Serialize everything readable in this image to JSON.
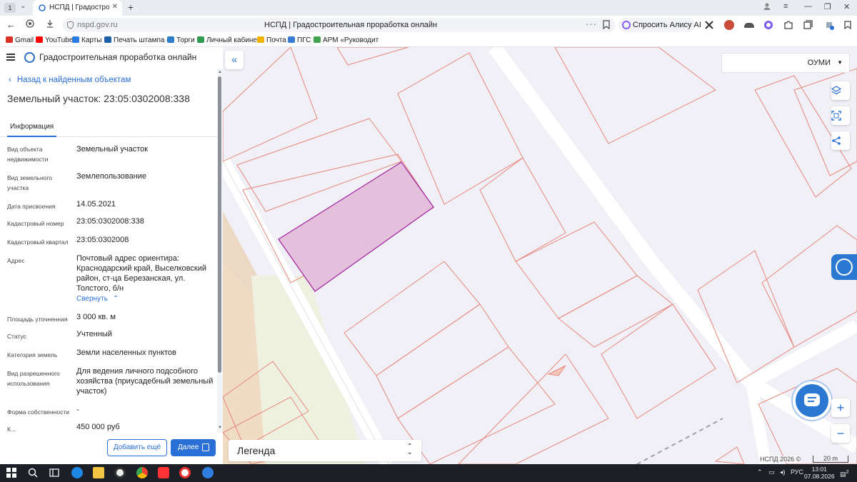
{
  "browser": {
    "tab_number": "1",
    "tab_title": "НСПД | Градостроительн",
    "url": "nspd.gov.ru",
    "page_title": "НСПД | Градостроительная проработка онлайн",
    "alisa_label": "Спросить Алису AI",
    "bookmarks": [
      {
        "label": "Gmail",
        "icon": "gmail-icon",
        "color": "#d93025"
      },
      {
        "label": "YouTube",
        "icon": "youtube-icon",
        "color": "#ff0000"
      },
      {
        "label": "Карты",
        "icon": "maps-icon",
        "color": "#2a7be4"
      },
      {
        "label": "Печать штампа с",
        "icon": "stamp-icon",
        "color": "#1b5fa8"
      },
      {
        "label": "Торги",
        "icon": "torgi-icon",
        "color": "#2f7dc9"
      },
      {
        "label": "Личный кабинет",
        "icon": "cabinet-icon",
        "color": "#2e9d4f"
      },
      {
        "label": "Почта",
        "icon": "mail-icon",
        "color": "#f0b400"
      },
      {
        "label": "ПГС",
        "icon": "pgs-icon",
        "color": "#3a7bd5"
      },
      {
        "label": "АРМ «Руководит",
        "icon": "arm-icon",
        "color": "#3fa34d"
      }
    ]
  },
  "app": {
    "title": "Градостроительная проработка онлайн"
  },
  "panel": {
    "back_label": "Назад к найденным объектам",
    "object_title": "Земельный участок: 23:05:0302008:338",
    "tab_info": "Информация",
    "rows": [
      {
        "key": "Вид объекта недвижимости",
        "value": "Земельный участок"
      },
      {
        "key": "Вид земельного участка",
        "value": "Землепользование"
      },
      {
        "key": "Дата присвоения",
        "value": "14.05.2021"
      },
      {
        "key": "Кадастровый номер",
        "value": "23:05:0302008:338"
      },
      {
        "key": "Кадастровый квартал",
        "value": "23:05:0302008"
      },
      {
        "key": "Адрес",
        "value": "Почтовый адрес ориентира: Краснодарский край, Выселковский район, ст-ца Березанская, ул. Толстого, б/н"
      },
      {
        "key": "Площадь уточненная",
        "value": "3 000 кв. м"
      },
      {
        "key": "Статус",
        "value": "Учтенный"
      },
      {
        "key": "Категория земель",
        "value": "Земли населенных пунктов"
      },
      {
        "key": "Вид разрешенного использования",
        "value": "Для ведения личного подсобного хозяйства (приусадебный земельный участок)"
      },
      {
        "key": "Форма собственности",
        "value": "-"
      },
      {
        "key": "К...",
        "value": "450 000 руб"
      }
    ],
    "collapse_label": "Свернуть",
    "add_more_label": "Добавить ещё",
    "next_label": "Далее"
  },
  "map": {
    "layer_value": "ОУМИ",
    "legend_label": "Легенда",
    "copyright": "НСПД 2026 ©",
    "scale_label": "20 m",
    "parcel_stroke": "#e7877c",
    "selected_fill": "#e4c0dc",
    "selected_stroke": "#a020a0"
  },
  "taskbar": {
    "lang": "РУС",
    "time": "13:01",
    "date": "07.08.2026",
    "notif_count": "2"
  }
}
